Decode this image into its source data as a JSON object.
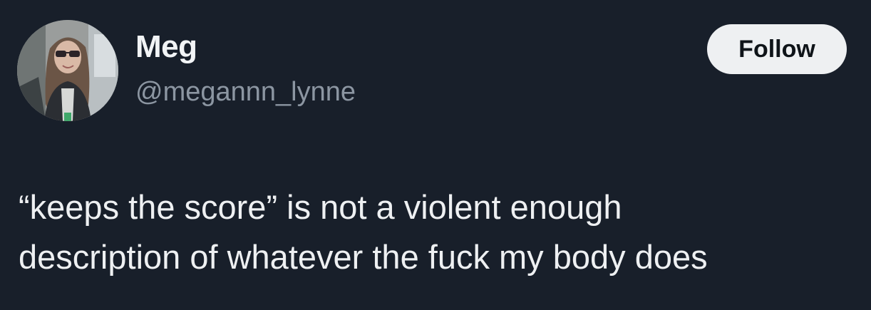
{
  "author": {
    "display_name": "Meg",
    "handle": "@megannn_lynne"
  },
  "follow_button": {
    "label": "Follow"
  },
  "tweet": {
    "lines": [
      "“keeps the score” is not a violent enough",
      "description of whatever the fuck my body does"
    ]
  }
}
